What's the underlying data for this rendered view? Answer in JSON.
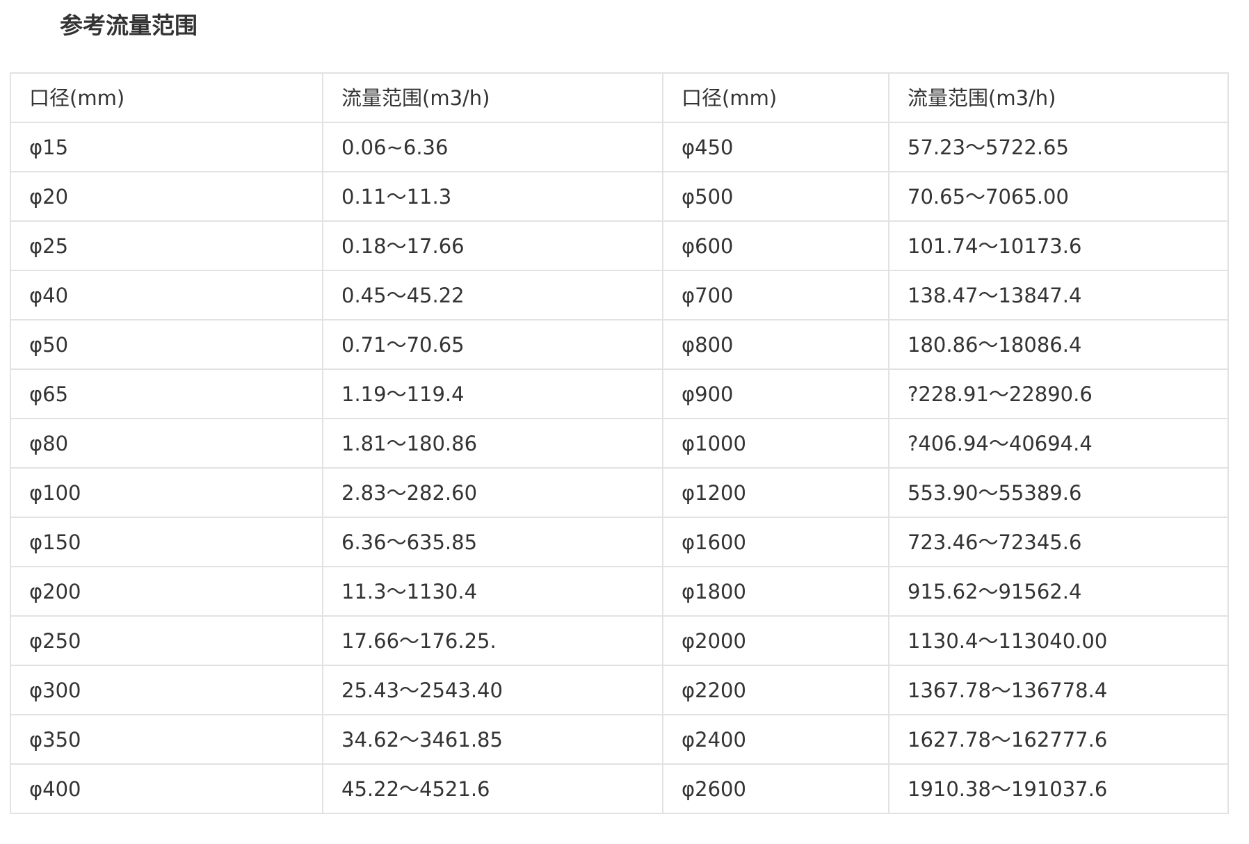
{
  "title": "参考流量范围",
  "table": {
    "headers": [
      "口径(mm)",
      "流量范围(m3/h)",
      "口径(mm)",
      "流量范围(m3/h)"
    ],
    "rows": [
      [
        "φ15",
        "0.06~6.36",
        "φ450",
        "57.23～5722.65"
      ],
      [
        "φ20",
        "0.11～11.3",
        "φ500",
        "70.65～7065.00"
      ],
      [
        "φ25",
        "0.18～17.66",
        "φ600",
        "101.74～10173.6"
      ],
      [
        "φ40",
        "0.45～45.22",
        "φ700",
        "138.47～13847.4"
      ],
      [
        "φ50",
        "0.71～70.65",
        "φ800",
        "180.86～18086.4"
      ],
      [
        "φ65",
        "1.19～119.4",
        "φ900",
        "?228.91～22890.6"
      ],
      [
        "φ80",
        "1.81～180.86",
        "φ1000",
        "?406.94～40694.4"
      ],
      [
        "φ100",
        "2.83～282.60",
        "φ1200",
        "553.90～55389.6"
      ],
      [
        "φ150",
        "6.36～635.85",
        "φ1600",
        "723.46～72345.6"
      ],
      [
        "φ200",
        "11.3～1130.4",
        "φ1800",
        "915.62～91562.4"
      ],
      [
        "φ250",
        "17.66～176.25.",
        "φ2000",
        "1130.4～113040.00"
      ],
      [
        "φ300",
        "25.43～2543.40",
        "φ2200",
        "1367.78～136778.4"
      ],
      [
        "φ350",
        "34.62～3461.85",
        "φ2400",
        "1627.78～162777.6"
      ],
      [
        "φ400",
        "45.22～4521.6",
        "φ2600",
        "1910.38～191037.6"
      ]
    ]
  }
}
